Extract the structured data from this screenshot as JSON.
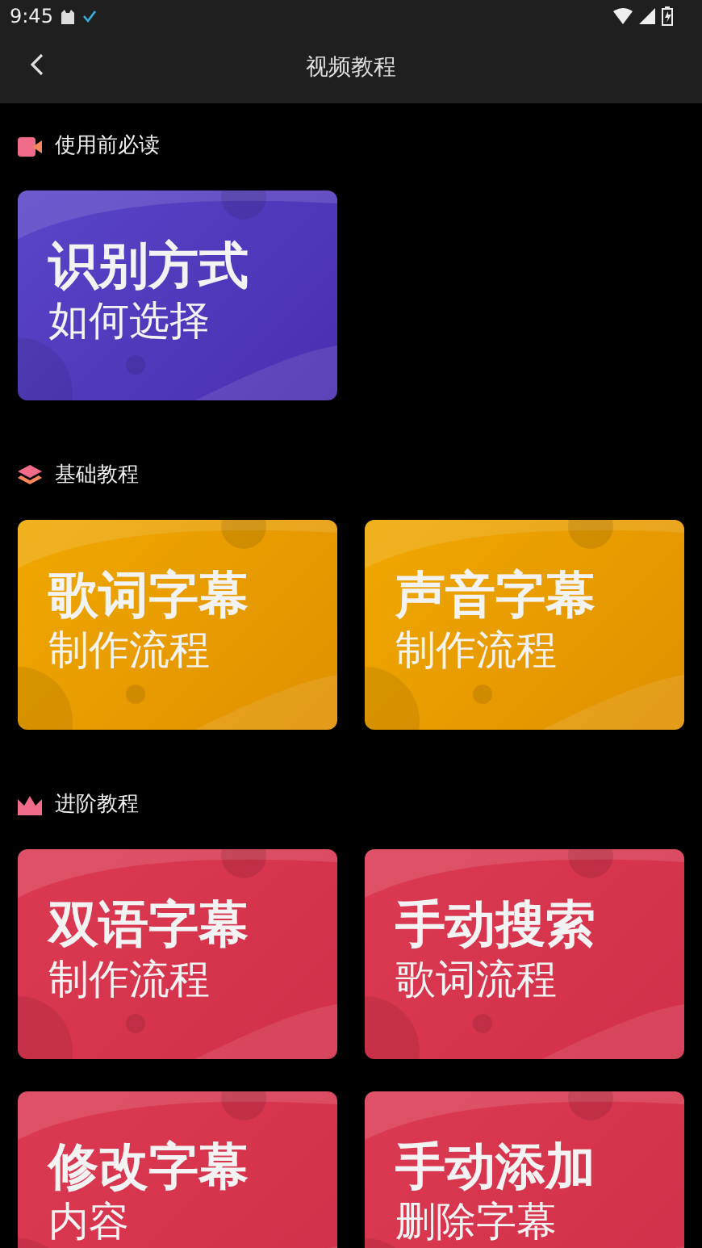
{
  "status_bar": {
    "time": "9:45"
  },
  "app_bar": {
    "title": "视频教程"
  },
  "sections": [
    {
      "title": "使用前必读",
      "kind": "video",
      "cards": [
        {
          "title": "识别方式",
          "subtitle": "如何选择"
        }
      ]
    },
    {
      "title": "基础教程",
      "kind": "layers",
      "cards": [
        {
          "title": "歌词字幕",
          "subtitle": "制作流程"
        },
        {
          "title": "声音字幕",
          "subtitle": "制作流程"
        }
      ]
    },
    {
      "title": "进阶教程",
      "kind": "crown",
      "cards": [
        {
          "title": "双语字幕",
          "subtitle": "制作流程"
        },
        {
          "title": "手动搜索",
          "subtitle": "歌词流程"
        },
        {
          "title": "修改字幕",
          "subtitle": "内容"
        },
        {
          "title": "手动添加",
          "subtitle": "删除字幕"
        }
      ]
    }
  ]
}
